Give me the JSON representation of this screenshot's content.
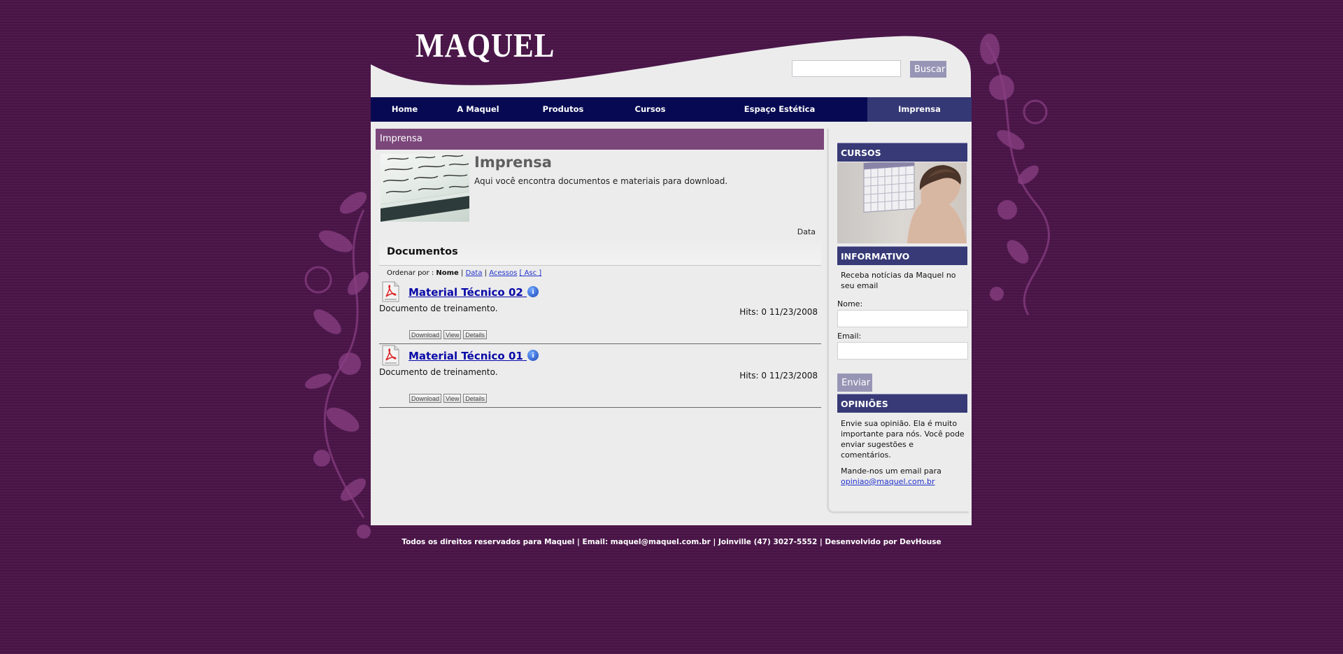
{
  "brand": {
    "logo_text": "MAQUEL"
  },
  "search": {
    "value": "",
    "placeholder": "",
    "button_label": "Buscar"
  },
  "nav": {
    "items": [
      {
        "label": "Home"
      },
      {
        "label": "A Maquel"
      },
      {
        "label": "Produtos"
      },
      {
        "label": "Cursos"
      },
      {
        "label": "Espaço Estética"
      },
      {
        "label": "Imprensa",
        "active": true
      }
    ]
  },
  "main": {
    "section_header": "Imprensa",
    "intro": {
      "title": "Imprensa",
      "description": "Aqui você encontra documentos e materiais para download."
    },
    "date_column": "Data",
    "documents_title": "Documentos",
    "order": {
      "label": "Ordenar por :",
      "current": "Nome",
      "sep": "|",
      "date": "Data",
      "hits": "Acessos",
      "asc": "[ Asc ]"
    },
    "documents": [
      {
        "title": "Material Técnico 02",
        "description": "Documento de treinamento.",
        "meta": "Hits: 0 11/23/2008",
        "download": "Download",
        "view": "View",
        "details": "Details"
      },
      {
        "title": "Material Técnico 01",
        "description": "Documento de treinamento.",
        "meta": "Hits: 0 11/23/2008",
        "download": "Download",
        "view": "View",
        "details": "Details"
      }
    ]
  },
  "sidebar": {
    "cursos": {
      "title": "CURSOS"
    },
    "informativo": {
      "title": "INFORMATIVO",
      "text": "Receba notícias da Maquel no seu email",
      "name_label": "Nome:",
      "name_value": "",
      "email_label": "Email:",
      "email_value": "",
      "button": "Enviar"
    },
    "opinioes": {
      "title": "OPINIÕES",
      "text": "Envie sua opinião. Ela é muito importante para nós. Você pode enviar sugestões e comentários.",
      "mail_prompt": "Mande-nos um email para",
      "email": "opiniao@maquel.com.br"
    }
  },
  "footer": {
    "text": "Todos os direitos reservados para Maquel | Email: maquel@maquel.com.br | Joinville (47) 3027-5552 | Desenvolvido por DevHouse"
  },
  "colors": {
    "background": "#4a1548",
    "nav": "#070a52",
    "nav_active": "#343874",
    "section_header": "#7b477b",
    "sidebar_header": "#373a76",
    "button": "#9795b5"
  },
  "icons": [
    "pdf-icon",
    "info-icon",
    "floral-ornament"
  ]
}
